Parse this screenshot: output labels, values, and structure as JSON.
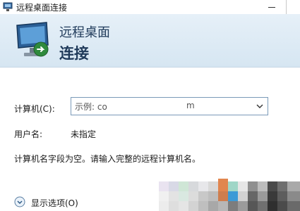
{
  "window": {
    "title": "远程桌面连接"
  },
  "header": {
    "line1": "远程桌面",
    "line2": "连接"
  },
  "form": {
    "computer_label": "计算机(C):",
    "computer_value": "示例: co",
    "computer_value_suffix": "m",
    "username_label": "用户名:",
    "username_value": "未指定",
    "message": "计算机名字段为空。请输入完整的远程计算机名。"
  },
  "options": {
    "label": "显示选项(O)"
  },
  "icons": {
    "app": "remote-desktop-icon",
    "header": "remote-desktop-monitor-icon",
    "dropdown": "chevron-down-icon",
    "expand": "expand-circle-icon"
  },
  "colors": {
    "header_bg": "#dce9f4",
    "header_text": "#1f3a5a",
    "combo_border": "#7a9ab8"
  }
}
